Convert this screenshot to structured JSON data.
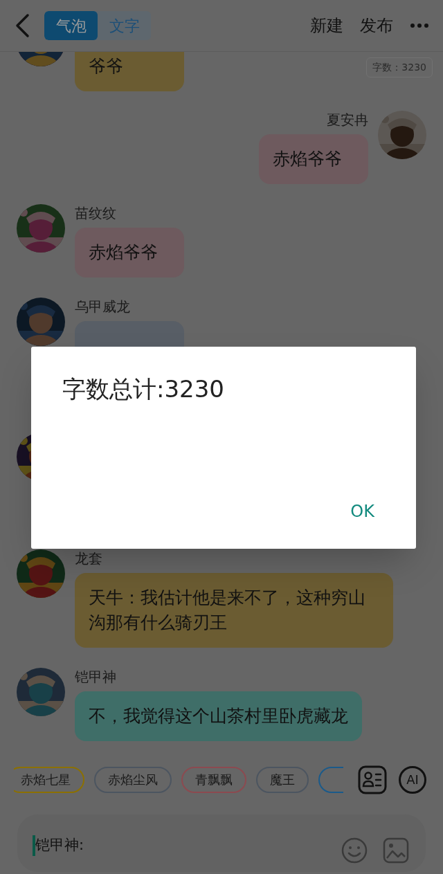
{
  "header": {
    "tabs": [
      {
        "label": "气泡",
        "selected": true
      },
      {
        "label": "文字",
        "selected": false
      }
    ],
    "actions": [
      "新建",
      "发布"
    ]
  },
  "word_count_badge": "字数：3230",
  "messages": [
    {
      "kind": "incoming",
      "text": "爷爷",
      "color": "#6b5c32"
    },
    {
      "kind": "outgoing",
      "name": "夏安冉",
      "text": "赤焰爷爷",
      "color": "#6e5a5e"
    },
    {
      "kind": "incoming",
      "name": "苗纹纹",
      "text": "赤焰爷爷",
      "color": "#6e5a5e"
    },
    {
      "kind": "incoming",
      "name": "乌甲威龙",
      "color": "#585e66"
    },
    {
      "kind": "avatar_only"
    },
    {
      "kind": "incoming",
      "name": "龙套",
      "text": "天牛：我估计他是来不了，这种穷山沟那有什么骑刃王",
      "color": "#6b5c32"
    },
    {
      "kind": "incoming",
      "name": "铠甲神",
      "text": "不，我觉得这个山茶村里卧虎藏龙",
      "color": "#3f6e68"
    }
  ],
  "chips": [
    {
      "kind": "label",
      "label": "赤焰七星",
      "color": "#8c7000"
    },
    {
      "kind": "label",
      "label": "赤焰尘风",
      "color": "#4c5560"
    },
    {
      "kind": "label",
      "label": "青飘飘",
      "color": "#8c4a50"
    },
    {
      "kind": "label",
      "label": "魔王",
      "color": "#4c5560"
    },
    {
      "kind": "edge",
      "color": "#1a5a8a"
    }
  ],
  "ai_button": "AI",
  "input": {
    "value": "铠甲神:"
  },
  "dialog": {
    "message": "字数总计:3230",
    "button": "OK"
  }
}
